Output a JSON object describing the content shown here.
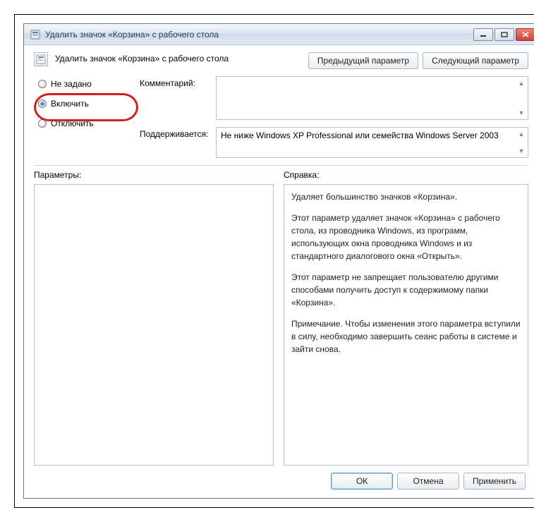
{
  "window": {
    "title": "Удалить значок «Корзина» с рабочего стола"
  },
  "header": {
    "title": "Удалить значок «Корзина» с рабочего стола",
    "prev_label": "Предыдущий параметр",
    "next_label": "Следующий параметр"
  },
  "radios": {
    "not_configured": "Не задано",
    "enabled": "Включить",
    "disabled": "Отключить",
    "selected": "enabled"
  },
  "comment": {
    "label": "Комментарий:",
    "value": ""
  },
  "supported": {
    "label": "Поддерживается:",
    "value": "Не ниже Windows XP Professional или семейства Windows Server 2003"
  },
  "params": {
    "label": "Параметры:"
  },
  "help": {
    "label": "Справка:",
    "p1": "Удаляет большинство значков «Корзина».",
    "p2": "Этот параметр удаляет значок «Корзина» с рабочего стола, из проводника Windows, из программ, использующих окна проводника Windows и из стандартного диалогового окна «Открыть».",
    "p3": "Этот параметр не запрещает пользователю другими способами получить доступ к содержимому папки «Корзина».",
    "p4": "Примечание. Чтобы изменения этого параметра вступили в силу, необходимо завершить сеанс работы в системе и зайти снова."
  },
  "footer": {
    "ok": "ОК",
    "cancel": "Отмена",
    "apply": "Применить"
  },
  "icons": {
    "app": "app-icon",
    "policy": "policy-icon"
  }
}
